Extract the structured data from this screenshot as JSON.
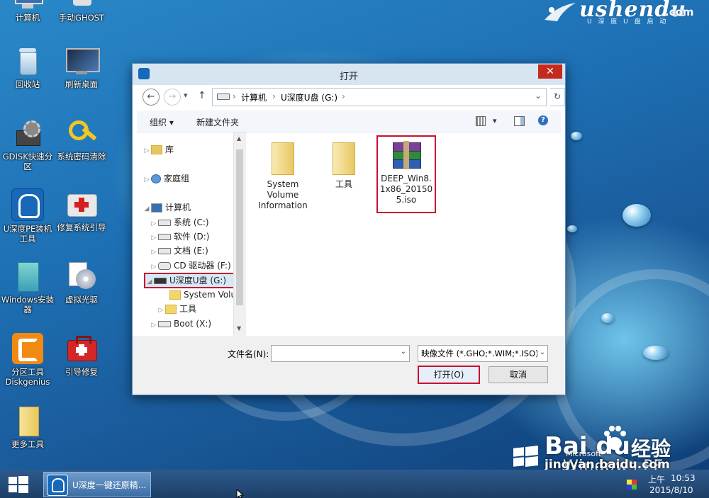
{
  "desktop": {
    "icons": [
      {
        "label": "计算机",
        "icon": "computer-icon"
      },
      {
        "label": "手动GHOST",
        "icon": "ghost-icon"
      },
      {
        "label": "回收站",
        "icon": "recycle-bin-icon"
      },
      {
        "label": "刷新桌面",
        "icon": "monitor-icon"
      },
      {
        "label": "GDISK快速分区",
        "icon": "gear-disk-icon"
      },
      {
        "label": "系统密码清除",
        "icon": "key-icon"
      },
      {
        "label": "U深度PE装机工具",
        "icon": "usd-ghost-icon"
      },
      {
        "label": "修复系统引导",
        "icon": "first-aid-kit-icon"
      },
      {
        "label": "Windows安装器",
        "icon": "windows-installer-icon"
      },
      {
        "label": "虚拟光驱",
        "icon": "virtual-drive-icon"
      },
      {
        "label": "分区工具Diskgenius",
        "icon": "diskgenius-icon"
      },
      {
        "label": "引导修复",
        "icon": "repair-kit-icon"
      },
      {
        "label": "更多工具",
        "icon": "folder-icon"
      }
    ],
    "brand": {
      "logo": "ushendu",
      "text": "ushendu",
      "domain": ".com",
      "slogan": "U 深 度 U 盘 启 动"
    },
    "watermark": {
      "brand": "Bai du",
      "paw": "paw-icon",
      "suffix": "经验",
      "url": "jingyan.baidu.com",
      "ms": "Microsoft",
      "product": "Windows PE"
    }
  },
  "dialog": {
    "title": "打开",
    "close": "✕",
    "address": {
      "back": "←",
      "forward": "→",
      "recent": "▾",
      "up": "↑",
      "crumbs": [
        "计算机",
        "U深度U盘 (G:)"
      ],
      "sep": "›",
      "dropdown": "⌄",
      "refresh": "↻"
    },
    "toolbar": {
      "organize": "组织 ▾",
      "new_folder": "新建文件夹",
      "view": "▾",
      "help": "?"
    },
    "nav": [
      {
        "label": "库",
        "arrow": "▷",
        "icon": "library-icon"
      },
      {
        "label": "家庭组",
        "arrow": "▷",
        "icon": "homegroup-icon"
      },
      {
        "label": "计算机",
        "arrow": "◢",
        "icon": "computer-icon"
      },
      {
        "label": "系统 (C:)",
        "arrow": "▷",
        "icon": "drive-icon"
      },
      {
        "label": "软件 (D:)",
        "arrow": "▷",
        "icon": "drive-icon"
      },
      {
        "label": "文档 (E:)",
        "arrow": "▷",
        "icon": "drive-icon"
      },
      {
        "label": "CD 驱动器 (F:) U",
        "arrow": "▷",
        "icon": "cd-drive-icon"
      },
      {
        "label": "U深度U盘 (G:)",
        "arrow": "◢",
        "icon": "usb-drive-icon"
      },
      {
        "label": "System Volum",
        "arrow": "",
        "icon": "folder-icon"
      },
      {
        "label": "工具",
        "arrow": "▷",
        "icon": "folder-icon"
      },
      {
        "label": "Boot (X:)",
        "arrow": "▷",
        "icon": "drive-icon"
      }
    ],
    "files": [
      {
        "name": "System Volume Information",
        "icon": "folder-icon"
      },
      {
        "name": "工具",
        "icon": "folder-icon"
      },
      {
        "name": "DEEP_Win8.1x86_201505.iso",
        "icon": "winrar-archive-icon"
      }
    ],
    "filename_label": "文件名(N):",
    "filename_value": "",
    "filetype": "映像文件 (*.GHO;*.WIM;*.ISO)",
    "open_button": "打开(O)",
    "cancel_button": "取消",
    "highlight_color": "#c8102e"
  },
  "taskbar": {
    "task_label": "U深度一键还原精...",
    "time": "10:53",
    "date": "2015/8/10",
    "ampm": "上午"
  }
}
